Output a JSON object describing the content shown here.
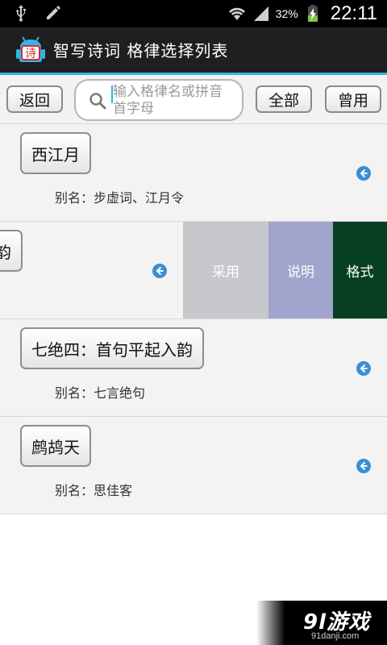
{
  "status_bar": {
    "battery_percent": "32%",
    "time": "22:11",
    "icons": [
      "usb-icon",
      "pencil-icon",
      "wifi-icon",
      "signal-icon",
      "battery-charging-icon"
    ]
  },
  "app": {
    "title": "智写诗词 格律选择列表",
    "logo_text": "诗"
  },
  "toolbar": {
    "back_label": "返回",
    "search_placeholder": "输入格律名或拼音首字母",
    "all_label": "全部",
    "common_label": "曾用"
  },
  "list": [
    {
      "name": "西江月",
      "alias": "别名：步虚词、江月令"
    },
    {
      "name": "入韵",
      "alias": ""
    },
    {
      "name": "七绝四：首句平起入韵",
      "alias": "别名：七言绝句"
    },
    {
      "name": "鹧鸪天",
      "alias": "别名：思佳客"
    }
  ],
  "swipe_actions": {
    "adopt_label": "采用",
    "explain_label": "说明",
    "format_label": "格式"
  },
  "watermark": {
    "main": "9l游戏",
    "sub": "91danji.com"
  },
  "colors": {
    "accent": "#33b5e5",
    "adopt": "#c6c8cb",
    "explain": "#a1a4cc",
    "format": "#073f22",
    "arrow": "#3a8fd6"
  }
}
